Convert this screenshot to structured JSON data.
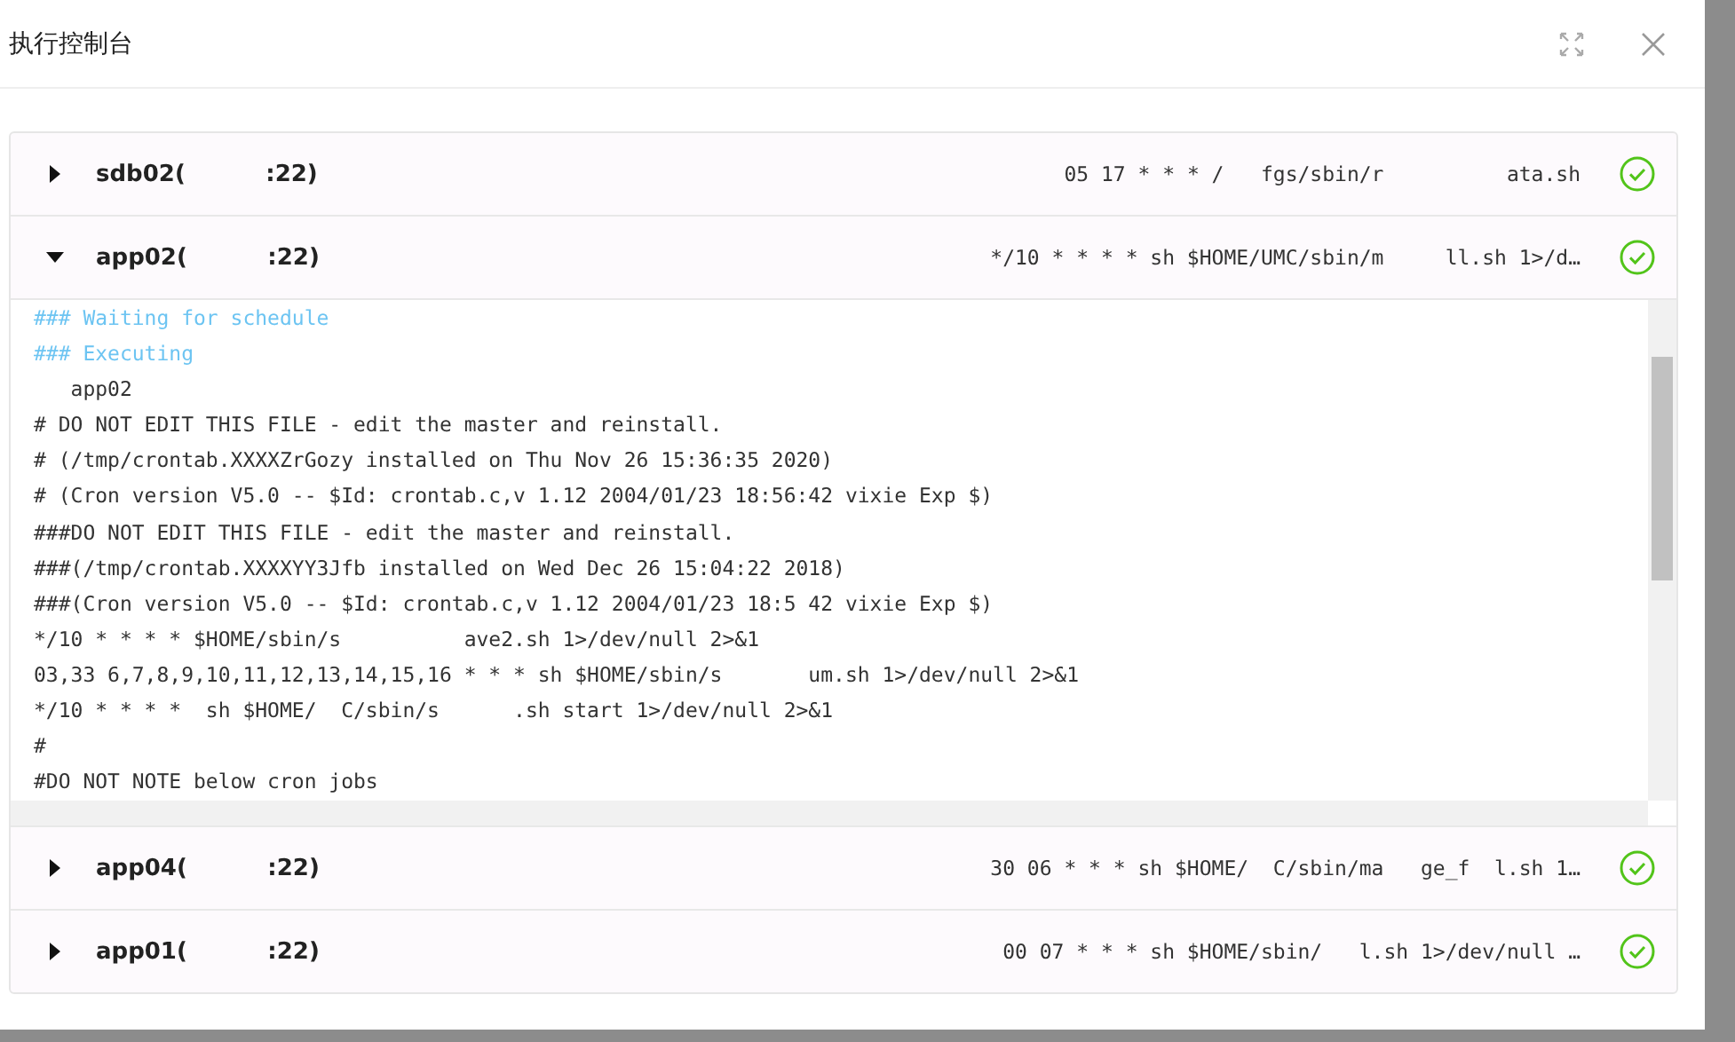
{
  "dialog": {
    "title": "执行控制台"
  },
  "hosts": [
    {
      "name": "sdb02(          :22)",
      "command": "05 17 * * * /   fgs/sbin/r          ata.sh",
      "color": "#52c41a",
      "expanded": false
    },
    {
      "name": "app02(          :22)",
      "command": "*/10 * * * * sh $HOME/UMC/sbin/m     ll.sh 1>/d…",
      "color": "#52c41a",
      "expanded": true,
      "log": [
        {
          "kind": "status",
          "text": "### Waiting for schedule"
        },
        {
          "kind": "status",
          "text": "### Executing"
        },
        {
          "kind": "output",
          "text": "   app02"
        },
        {
          "kind": "output",
          "text": "# DO NOT EDIT THIS FILE - edit the master and reinstall."
        },
        {
          "kind": "output",
          "text": "# (/tmp/crontab.XXXXZrGozy installed on Thu Nov 26 15:36:35 2020)"
        },
        {
          "kind": "output",
          "text": "# (Cron version V5.0 -- $Id: crontab.c,v 1.12 2004/01/23 18:56:42 vixie Exp $)"
        },
        {
          "kind": "output",
          "text": "###DO NOT EDIT THIS FILE - edit the master and reinstall."
        },
        {
          "kind": "output",
          "text": "###(/tmp/crontab.XXXXYY3Jfb installed on Wed Dec 26 15:04:22 2018)"
        },
        {
          "kind": "output",
          "text": "###(Cron version V5.0 -- $Id: crontab.c,v 1.12 2004/01/23 18:5 42 vixie Exp $)"
        },
        {
          "kind": "output",
          "text": "*/10 * * * * $HOME/sbin/s          ave2.sh 1>/dev/null 2>&1"
        },
        {
          "kind": "output",
          "text": "03,33 6,7,8,9,10,11,12,13,14,15,16 * * * sh $HOME/sbin/s       um.sh 1>/dev/null 2>&1"
        },
        {
          "kind": "output",
          "text": "*/10 * * * *  sh $HOME/  C/sbin/s      .sh start 1>/dev/null 2>&1"
        },
        {
          "kind": "output",
          "text": "#"
        },
        {
          "kind": "output",
          "text": "#DO NOT NOTE below cron jobs"
        }
      ]
    },
    {
      "name": "app04(          :22)",
      "command": "30 06 * * * sh $HOME/  C/sbin/ma   ge_f  l.sh 1…",
      "color": "#52c41a",
      "expanded": false
    },
    {
      "name": "app01(          :22)",
      "command": "00 07 * * * sh $HOME/sbin/   l.sh 1>/dev/null …",
      "color": "#52c41a",
      "expanded": false
    }
  ]
}
